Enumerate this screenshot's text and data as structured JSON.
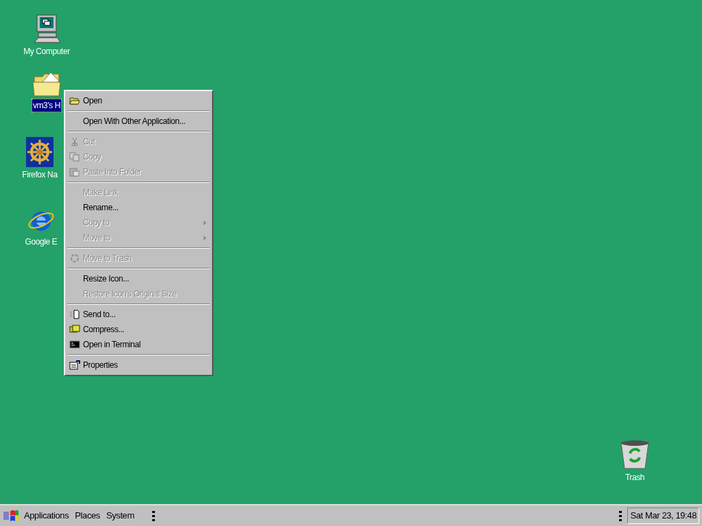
{
  "desktop_icons": [
    {
      "label": "My Computer",
      "selected": false
    },
    {
      "label": "vm3's H",
      "selected": true
    },
    {
      "label": "Firefox Na",
      "selected": false
    },
    {
      "label": "Google E",
      "selected": false
    },
    {
      "label": "Trash",
      "selected": false
    }
  ],
  "context_menu": {
    "items": [
      {
        "kind": "item",
        "label": "Open",
        "disabled": false,
        "submenu": false
      },
      {
        "kind": "separator"
      },
      {
        "kind": "item",
        "label": "Open With Other Application...",
        "disabled": false,
        "submenu": false
      },
      {
        "kind": "separator"
      },
      {
        "kind": "item",
        "label": "Cut",
        "disabled": true,
        "submenu": false
      },
      {
        "kind": "item",
        "label": "Copy",
        "disabled": true,
        "submenu": false
      },
      {
        "kind": "item",
        "label": "Paste Into Folder",
        "disabled": true,
        "submenu": false
      },
      {
        "kind": "separator"
      },
      {
        "kind": "item",
        "label": "Make Link",
        "disabled": true,
        "submenu": false
      },
      {
        "kind": "item",
        "label": "Rename...",
        "disabled": false,
        "submenu": false
      },
      {
        "kind": "item",
        "label": "Copy to",
        "disabled": true,
        "submenu": true
      },
      {
        "kind": "item",
        "label": "Move to",
        "disabled": true,
        "submenu": true
      },
      {
        "kind": "separator"
      },
      {
        "kind": "item",
        "label": "Move to Trash",
        "disabled": true,
        "submenu": false
      },
      {
        "kind": "separator"
      },
      {
        "kind": "item",
        "label": "Resize Icon...",
        "disabled": false,
        "submenu": false
      },
      {
        "kind": "item",
        "label": "Restore Icon's Original Size",
        "disabled": true,
        "submenu": false
      },
      {
        "kind": "separator"
      },
      {
        "kind": "item",
        "label": "Send to...",
        "disabled": false,
        "submenu": false
      },
      {
        "kind": "item",
        "label": "Compress...",
        "disabled": false,
        "submenu": false
      },
      {
        "kind": "item",
        "label": "Open in Terminal",
        "disabled": false,
        "submenu": false
      },
      {
        "kind": "separator"
      },
      {
        "kind": "item",
        "label": "Properties",
        "disabled": false,
        "submenu": false
      }
    ]
  },
  "taskbar": {
    "menus": [
      "Applications",
      "Places",
      "System"
    ],
    "clock": "Sat Mar 23, 19:48"
  }
}
